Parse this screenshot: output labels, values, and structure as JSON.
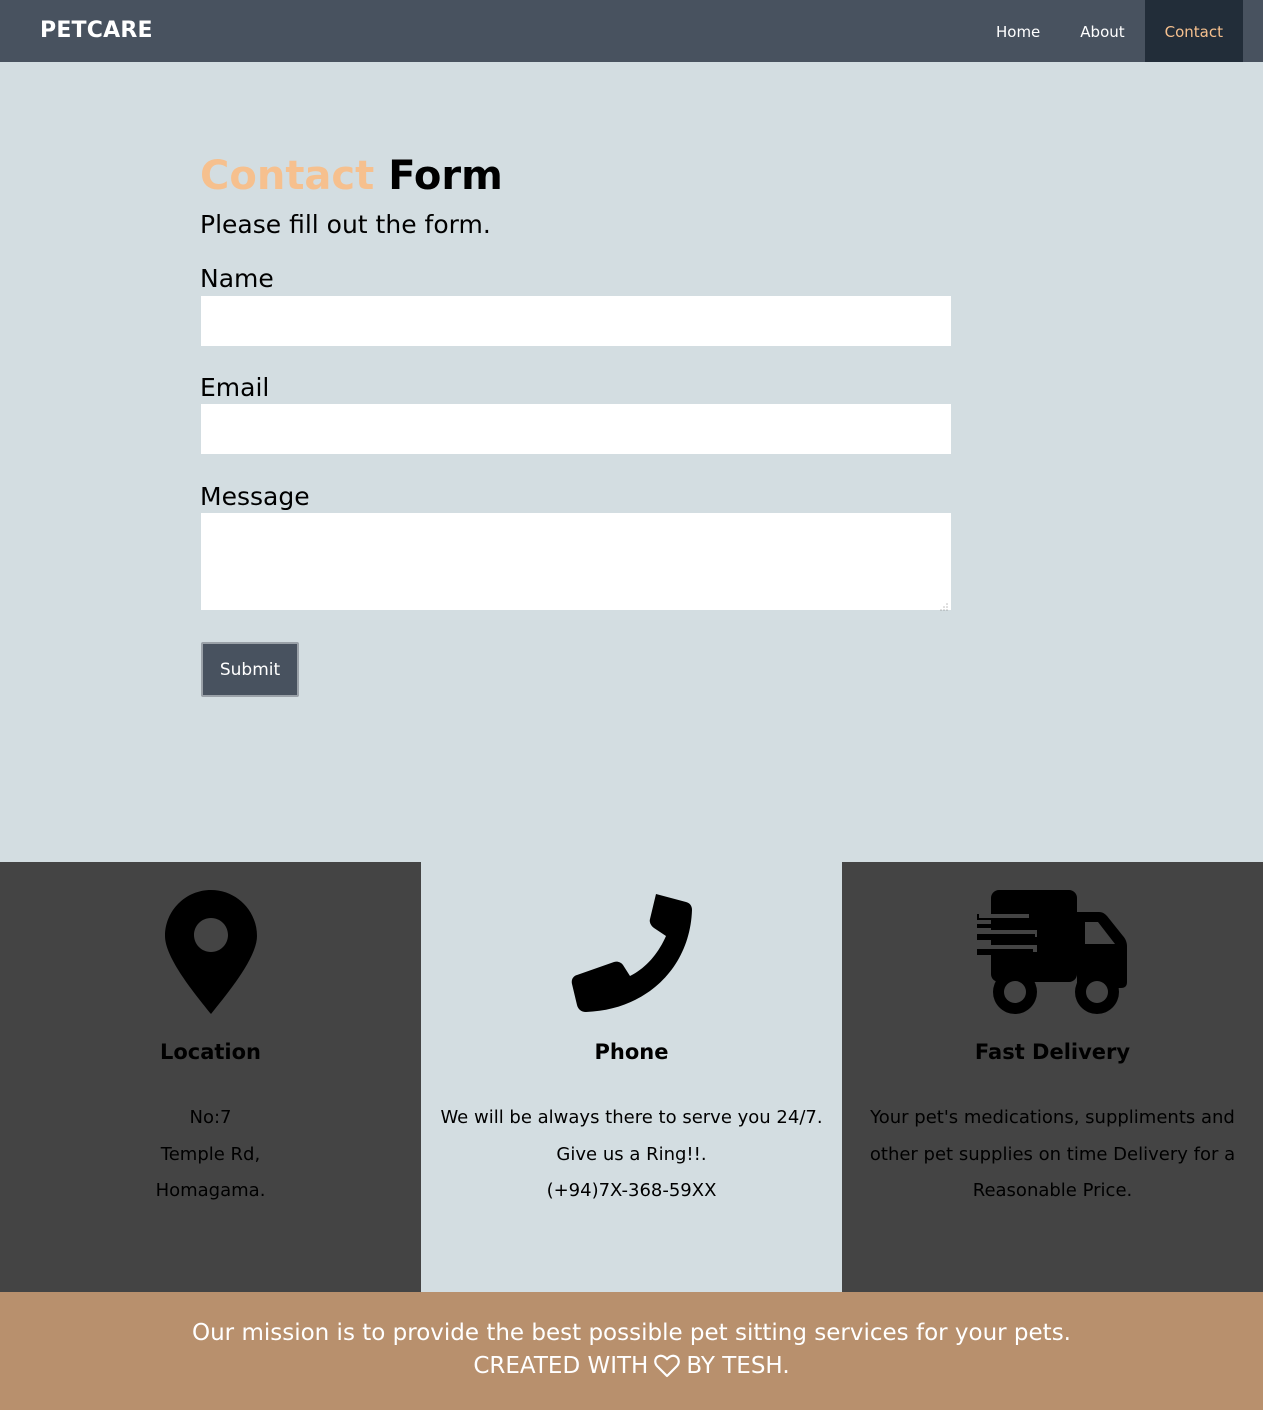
{
  "header": {
    "brand": "PETCARE",
    "nav": [
      {
        "label": "Home"
      },
      {
        "label": "About"
      },
      {
        "label": "Contact"
      }
    ]
  },
  "form": {
    "heading_accent": "Contact",
    "heading_rest": "Form",
    "subtitle": "Please fill out the form.",
    "name_label": "Name",
    "name_value": "",
    "email_label": "Email",
    "email_value": "",
    "message_label": "Message",
    "message_value": "",
    "submit_label": "Submit"
  },
  "cards": [
    {
      "icon": "map-pin-icon",
      "title": "Location",
      "lines": [
        "No:7",
        "Temple Rd,",
        "Homagama."
      ]
    },
    {
      "icon": "phone-icon",
      "title": "Phone",
      "lines": [
        "We will be always there to serve you 24/7.",
        "Give us a Ring!!.",
        "(+94)7X-368-59XX"
      ]
    },
    {
      "icon": "delivery-truck-icon",
      "title": "Fast Delivery",
      "lines": [
        "Your pet's medications, suppliments and other pet supplies on time Delivery for a Reasonable Price."
      ]
    }
  ],
  "footer": {
    "mission": "Our mission is to provide the best possible pet sitting services for your pets.",
    "credit_before": "CREATED WITH",
    "credit_icon": "heart-icon",
    "credit_after": "BY TESH."
  },
  "colors": {
    "navbar": "#48525f",
    "nav_active_bg": "#222d39",
    "accent": "#f6c08e",
    "page_bg": "#d3dde1",
    "card_dark": "#444444",
    "footer": "#b8906d"
  }
}
